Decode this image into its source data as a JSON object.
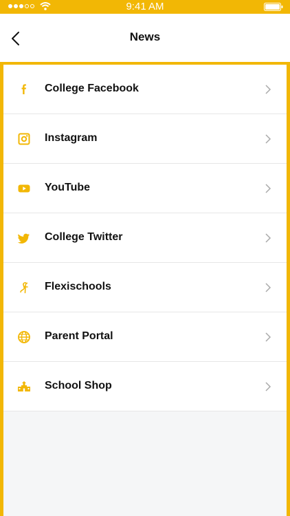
{
  "status_bar": {
    "time": "9:41 AM",
    "signal_bars": 3,
    "signal_total": 5,
    "wifi_icon": "wifi-icon",
    "battery_icon": "battery-icon"
  },
  "nav": {
    "title": "News",
    "back_icon": "chevron-left-icon"
  },
  "accent_color": "#f2b705",
  "items": [
    {
      "label": "College Facebook",
      "icon": "facebook-icon"
    },
    {
      "label": "Instagram",
      "icon": "instagram-icon"
    },
    {
      "label": "YouTube",
      "icon": "youtube-icon"
    },
    {
      "label": "College Twitter",
      "icon": "twitter-icon"
    },
    {
      "label": "Flexischools",
      "icon": "flexischools-icon"
    },
    {
      "label": "Parent Portal",
      "icon": "globe-icon"
    },
    {
      "label": "School Shop",
      "icon": "shop-icon"
    }
  ]
}
